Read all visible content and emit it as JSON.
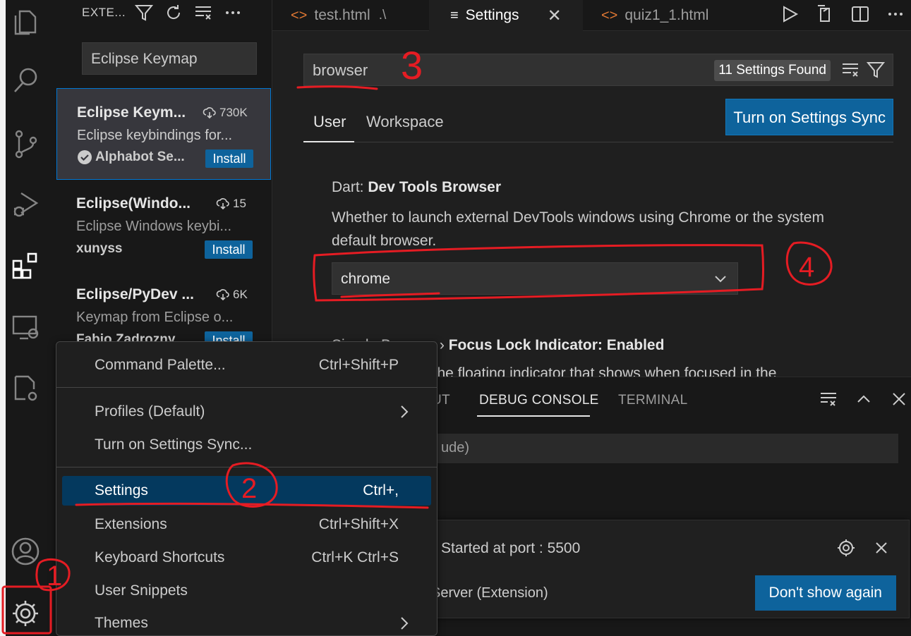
{
  "sidebar": {
    "header": "EXTE...",
    "search_value": "Eclipse Keymap",
    "extensions": [
      {
        "title": "Eclipse Keym...",
        "downloads": "730K",
        "description": "Eclipse keybindings for...",
        "publisher": "Alphabot Se...",
        "verified": true,
        "button": "Install"
      },
      {
        "title": "Eclipse(Windo...",
        "downloads": "15",
        "description": "Eclipse Windows keybi...",
        "publisher": "xunyss",
        "verified": false,
        "button": "Install"
      },
      {
        "title": "Eclipse/PyDev ...",
        "downloads": "6K",
        "description": "Keymap from Eclipse o...",
        "publisher": "Fabio Zadrozny",
        "verified": false,
        "button": "Install"
      }
    ]
  },
  "tabs": [
    {
      "label": "test.html",
      "hint": ".\\",
      "icon": "html-icon"
    },
    {
      "label": "Settings",
      "icon": "settings-file-icon",
      "active": true
    },
    {
      "label": "quiz1_1.html",
      "icon": "html-icon"
    }
  ],
  "settings": {
    "search_value": "browser",
    "found_label": "11 Settings Found",
    "scope_tabs": [
      "User",
      "Workspace"
    ],
    "sync_button": "Turn on Settings Sync",
    "setting1": {
      "category": "Dart: ",
      "name": "Dev Tools Browser",
      "description": "Whether to launch external DevTools windows using Chrome or the system default browser.",
      "value": "chrome"
    },
    "setting2": {
      "category": "Simple Browser › ",
      "name": "Focus Lock Indicator: ",
      "value": "Enabled",
      "description": "Enable/disable the floating indicator that shows when focused in the"
    }
  },
  "panel": {
    "tabs": [
      "UT",
      "DEBUG CONSOLE",
      "TERMINAL"
    ],
    "active_tab": "DEBUG CONSOLE",
    "filter_fragment": "ude)"
  },
  "notification": {
    "message": "Started at port : 5500",
    "source": "Server (Extension)",
    "button": "Don't show again"
  },
  "menu": {
    "items": [
      {
        "label": "Command Palette...",
        "shortcut": "Ctrl+Shift+P"
      },
      {
        "label": "Profiles (Default)",
        "shortcut": ""
      },
      {
        "label": "Turn on Settings Sync...",
        "shortcut": ""
      },
      {
        "label": "Settings",
        "shortcut": "Ctrl+,"
      },
      {
        "label": "Extensions",
        "shortcut": "Ctrl+Shift+X"
      },
      {
        "label": "Keyboard Shortcuts",
        "shortcut": "Ctrl+K Ctrl+S"
      },
      {
        "label": "User Snippets",
        "shortcut": ""
      },
      {
        "label": "Themes",
        "shortcut": ""
      }
    ]
  },
  "annotations": {
    "marks": [
      "1",
      "2",
      "3",
      "4"
    ],
    "color": "#e51c23"
  },
  "colors": {
    "accent_blue": "#0e639c",
    "menu_highlight": "#04395e",
    "html_icon": "#e37933"
  }
}
